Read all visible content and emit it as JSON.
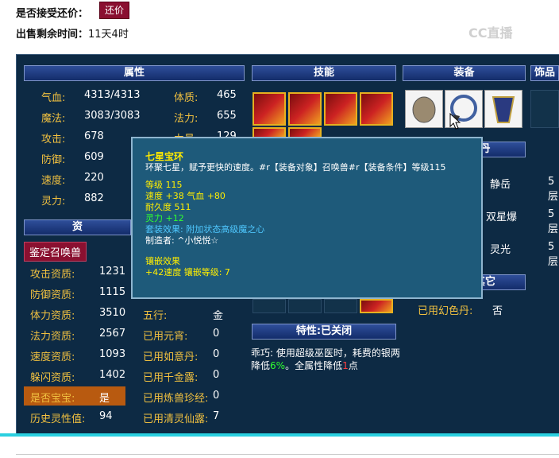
{
  "top": {
    "accept_haggle_label": "是否接受还价：",
    "haggle_button": "还价",
    "remaining_label": "出售剩余时间：",
    "remaining_value": "11天4时",
    "logo": "CC直播"
  },
  "headers": {
    "attributes": "属性",
    "skills": "技能",
    "equipment": "装备",
    "ornaments": "饰品",
    "traits": "特性:已关闭",
    "other": "其它",
    "partial_a": "资",
    "partial_b": "丹"
  },
  "attributes": [
    {
      "label": "气血:",
      "value": "4313/4313"
    },
    {
      "label": "魔法:",
      "value": "3083/3083"
    },
    {
      "label": "攻击:",
      "value": "678"
    },
    {
      "label": "防御:",
      "value": "609"
    },
    {
      "label": "速度:",
      "value": "220"
    },
    {
      "label": "灵力:",
      "value": "882"
    }
  ],
  "attributes_right": [
    {
      "label": "体质:",
      "value": "465"
    },
    {
      "label": "法力:",
      "value": "655"
    },
    {
      "label": "力量:",
      "value": "129"
    }
  ],
  "identify_button": "鉴定召唤兽",
  "aptitudes": [
    {
      "label": "攻击资质:",
      "value": "1231"
    },
    {
      "label": "防御资质:",
      "value": "1115"
    },
    {
      "label": "体力资质:",
      "value": "3510"
    },
    {
      "label": "法力资质:",
      "value": "2567"
    },
    {
      "label": "速度资质:",
      "value": "1093"
    },
    {
      "label": "躲闪资质:",
      "value": "1402"
    },
    {
      "label": "是否宝宝:",
      "value": "是"
    },
    {
      "label": "历史灵性值:",
      "value": "94"
    }
  ],
  "misc": [
    {
      "label": "五行:",
      "value": "金"
    },
    {
      "label": "已用元宵:",
      "value": "0"
    },
    {
      "label": "已用如意丹:",
      "value": "0"
    },
    {
      "label": "已用千金露:",
      "value": "0"
    },
    {
      "label": "已用炼兽珍经:",
      "value": "0"
    },
    {
      "label": "已用清灵仙露:",
      "value": "7"
    }
  ],
  "neidan": [
    {
      "name": "静岳",
      "level": "5层"
    },
    {
      "name": "双星爆",
      "level": "5层"
    },
    {
      "name": "灵光",
      "level": "5层"
    }
  ],
  "other": {
    "label": "已用幻色丹:",
    "value": "否"
  },
  "tooltip": {
    "title": "七星宝环",
    "desc": "环聚七星，赋予更快的速度。#r【装备对象】召唤兽#r【装备条件】等级115",
    "level": "等级 115",
    "speed_label": "速度 +38",
    "hp_label": "气血",
    "hp_value": "+80",
    "durability": "耐久度 511",
    "spirit": "灵力 +12",
    "set_effect": "套装效果: 附加状态高级魔之心",
    "maker": "制造者: ^小悦悦☆",
    "inlay_title": "镶嵌效果",
    "inlay_value": "+42速度 镶嵌等级: 7"
  },
  "trait_text": {
    "part1": "乖巧: 使用超级巫医时，耗费的银两降低",
    "pct1": "6%",
    "part2": "。全属性降低",
    "num2": "1",
    "part3": "点"
  }
}
